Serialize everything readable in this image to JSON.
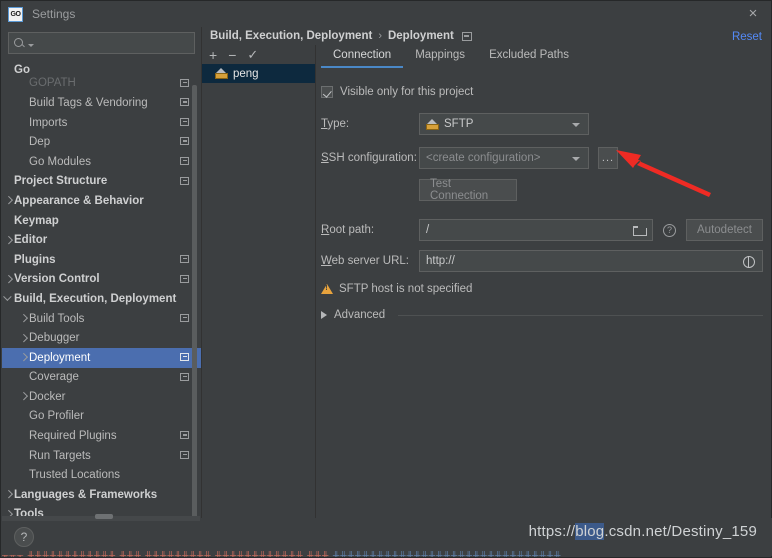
{
  "window": {
    "title": "Settings",
    "app_icon": "go-icon",
    "close_icon": "×",
    "reset_label": "Reset"
  },
  "sidebar": {
    "search": {
      "value": "",
      "placeholder": ""
    },
    "items": [
      {
        "label": "Go",
        "bold": true,
        "indent": 12,
        "arrow": "",
        "badge": false
      },
      {
        "label": "GOPATH",
        "bold": false,
        "indent": 27,
        "arrow": "",
        "badge": true,
        "clipped": true
      },
      {
        "label": "Build Tags & Vendoring",
        "bold": false,
        "indent": 27,
        "arrow": "",
        "badge": true
      },
      {
        "label": "Imports",
        "bold": false,
        "indent": 27,
        "arrow": "",
        "badge": true
      },
      {
        "label": "Dep",
        "bold": false,
        "indent": 27,
        "arrow": "",
        "badge": true
      },
      {
        "label": "Go Modules",
        "bold": false,
        "indent": 27,
        "arrow": "",
        "badge": true
      },
      {
        "label": "Project Structure",
        "bold": true,
        "indent": 12,
        "arrow": "",
        "badge": true
      },
      {
        "label": "Appearance & Behavior",
        "bold": true,
        "indent": 12,
        "arrow": "closed",
        "badge": false
      },
      {
        "label": "Keymap",
        "bold": true,
        "indent": 12,
        "arrow": "",
        "badge": false
      },
      {
        "label": "Editor",
        "bold": true,
        "indent": 12,
        "arrow": "closed",
        "badge": false
      },
      {
        "label": "Plugins",
        "bold": true,
        "indent": 12,
        "arrow": "",
        "badge": true
      },
      {
        "label": "Version Control",
        "bold": true,
        "indent": 12,
        "arrow": "closed",
        "badge": true
      },
      {
        "label": "Build, Execution, Deployment",
        "bold": true,
        "indent": 12,
        "arrow": "open",
        "badge": false
      },
      {
        "label": "Build Tools",
        "bold": false,
        "indent": 27,
        "arrow": "closed",
        "badge": true
      },
      {
        "label": "Debugger",
        "bold": false,
        "indent": 27,
        "arrow": "closed",
        "badge": false
      },
      {
        "label": "Deployment",
        "bold": false,
        "indent": 27,
        "arrow": "closed",
        "badge": true,
        "selected": true
      },
      {
        "label": "Coverage",
        "bold": false,
        "indent": 27,
        "arrow": "",
        "badge": true
      },
      {
        "label": "Docker",
        "bold": false,
        "indent": 27,
        "arrow": "closed",
        "badge": false
      },
      {
        "label": "Go Profiler",
        "bold": false,
        "indent": 27,
        "arrow": "",
        "badge": false
      },
      {
        "label": "Required Plugins",
        "bold": false,
        "indent": 27,
        "arrow": "",
        "badge": true
      },
      {
        "label": "Run Targets",
        "bold": false,
        "indent": 27,
        "arrow": "",
        "badge": true
      },
      {
        "label": "Trusted Locations",
        "bold": false,
        "indent": 27,
        "arrow": "",
        "badge": false
      },
      {
        "label": "Languages & Frameworks",
        "bold": true,
        "indent": 12,
        "arrow": "closed",
        "badge": false
      },
      {
        "label": "Tools",
        "bold": true,
        "indent": 12,
        "arrow": "closed",
        "badge": false
      }
    ]
  },
  "breadcrumb": {
    "root": "Build, Execution, Deployment",
    "separator": "›",
    "leaf": "Deployment"
  },
  "list": {
    "toolbar": {
      "add": "+",
      "remove": "−",
      "default": "✓"
    },
    "items": [
      {
        "label": "peng",
        "icon": "server-icon",
        "selected": true
      }
    ]
  },
  "tabs": [
    {
      "label": "Connection",
      "active": true
    },
    {
      "label": "Mappings",
      "active": false
    },
    {
      "label": "Excluded Paths",
      "active": false
    }
  ],
  "form": {
    "visible_only_label": "Visible only for this project",
    "visible_only_checked": true,
    "type_label": "Type:",
    "type_value": "SFTP",
    "ssh_label": "SSH configuration:",
    "ssh_value": "<create configuration>",
    "ssh_dots_label": "...",
    "test_connection_label": "Test Connection",
    "root_path_label": "Root path:",
    "root_path_value": "/",
    "autodetect_label": "Autodetect",
    "help_icon_label": "?",
    "web_url_label": "Web server URL:",
    "web_url_value": "http://",
    "warning_text": "SFTP host is not specified",
    "advanced_label": "Advanced"
  },
  "bottom": {
    "help_label": "?"
  },
  "watermark": {
    "prefix": "https://",
    "highlight1": "blog",
    "mid": ".csdn.net/",
    "highlight2": "Destiny",
    "suffix": "_159"
  },
  "colors": {
    "accent_blue": "#4a88c7",
    "selection_blue": "#4b6eaf",
    "link_blue": "#548af7",
    "warning_orange": "#e8a33d",
    "arrow_red": "#ef2b24",
    "panel_bg": "#3c3f41",
    "list_selected_bg": "#0d293e"
  }
}
